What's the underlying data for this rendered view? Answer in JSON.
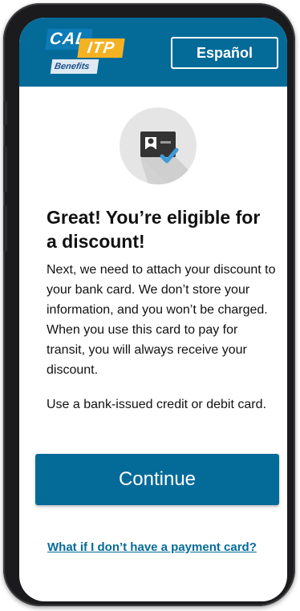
{
  "header": {
    "logo": {
      "cal": "CAL",
      "itp": "ITP",
      "benefits": "Benefits"
    },
    "language_button": "Español"
  },
  "main": {
    "icon": "verified-id-card-icon",
    "heading": "Great! You’re eligible for a discount!",
    "paragraph_1": "Next, we need to attach your discount to your bank card. We don’t store your information, and you won’t be charged. When you use this card to pay for transit, you will always receive your discount.",
    "paragraph_2": "Use a bank-issued credit or debit card.",
    "continue_button": "Continue",
    "help_link": "What if I don’t have a payment card?"
  },
  "colors": {
    "brand_blue": "#046b99",
    "logo_blue": "#0d7bb5",
    "logo_yellow": "#f4b223",
    "check_blue": "#3d9bd8"
  }
}
